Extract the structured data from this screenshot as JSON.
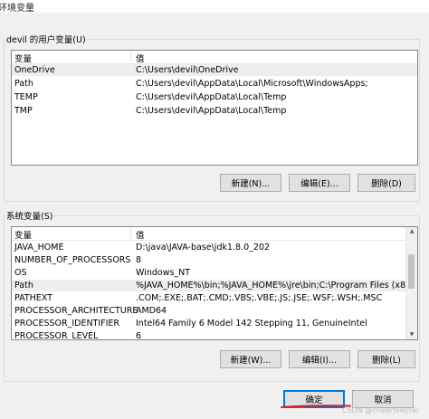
{
  "window": {
    "title": "环境变量"
  },
  "user_vars": {
    "label": "devil 的用户变量(U)",
    "headers": {
      "name": "变量",
      "value": "值"
    },
    "rows": [
      {
        "name": "OneDrive",
        "value": "C:\\Users\\devil\\OneDrive"
      },
      {
        "name": "Path",
        "value": "C:\\Users\\devil\\AppData\\Local\\Microsoft\\WindowsApps;"
      },
      {
        "name": "TEMP",
        "value": "C:\\Users\\devil\\AppData\\Local\\Temp"
      },
      {
        "name": "TMP",
        "value": "C:\\Users\\devil\\AppData\\Local\\Temp"
      }
    ],
    "buttons": {
      "new": "新建(N)...",
      "edit": "编辑(E)...",
      "delete": "删除(D)"
    }
  },
  "system_vars": {
    "label": "系统变量(S)",
    "headers": {
      "name": "变量",
      "value": "值"
    },
    "rows": [
      {
        "name": "JAVA_HOME",
        "value": "D:\\java\\JAVA-base\\jdk1.8.0_202"
      },
      {
        "name": "NUMBER_OF_PROCESSORS",
        "value": "8"
      },
      {
        "name": "OS",
        "value": "Windows_NT"
      },
      {
        "name": "Path",
        "value": "%JAVA_HOME%\\bin;%JAVA_HOME%\\jre\\bin;C:\\Program Files (x8..."
      },
      {
        "name": "PATHEXT",
        "value": ".COM;.EXE;.BAT;.CMD;.VBS;.VBE;.JS;.JSE;.WSF;.WSH;.MSC"
      },
      {
        "name": "PROCESSOR_ARCHITECTURE",
        "value": "AMD64"
      },
      {
        "name": "PROCESSOR_IDENTIFIER",
        "value": "Intel64 Family 6 Model 142 Stepping 11, GenuineIntel"
      },
      {
        "name": "PROCESSOR_LEVEL",
        "value": "6"
      }
    ],
    "buttons": {
      "new": "新建(W)...",
      "edit": "编辑(I)...",
      "delete": "删除(L)"
    }
  },
  "dialog_buttons": {
    "ok": "确定",
    "cancel": "取消"
  },
  "watermark": "CSDN @cheerfeeyoki",
  "colors": {
    "underline": "#e02020",
    "default_border": "#0078d7"
  },
  "icons": {
    "scroll_up": "scroll-up-arrow-icon",
    "scroll_down": "scroll-down-arrow-icon"
  }
}
